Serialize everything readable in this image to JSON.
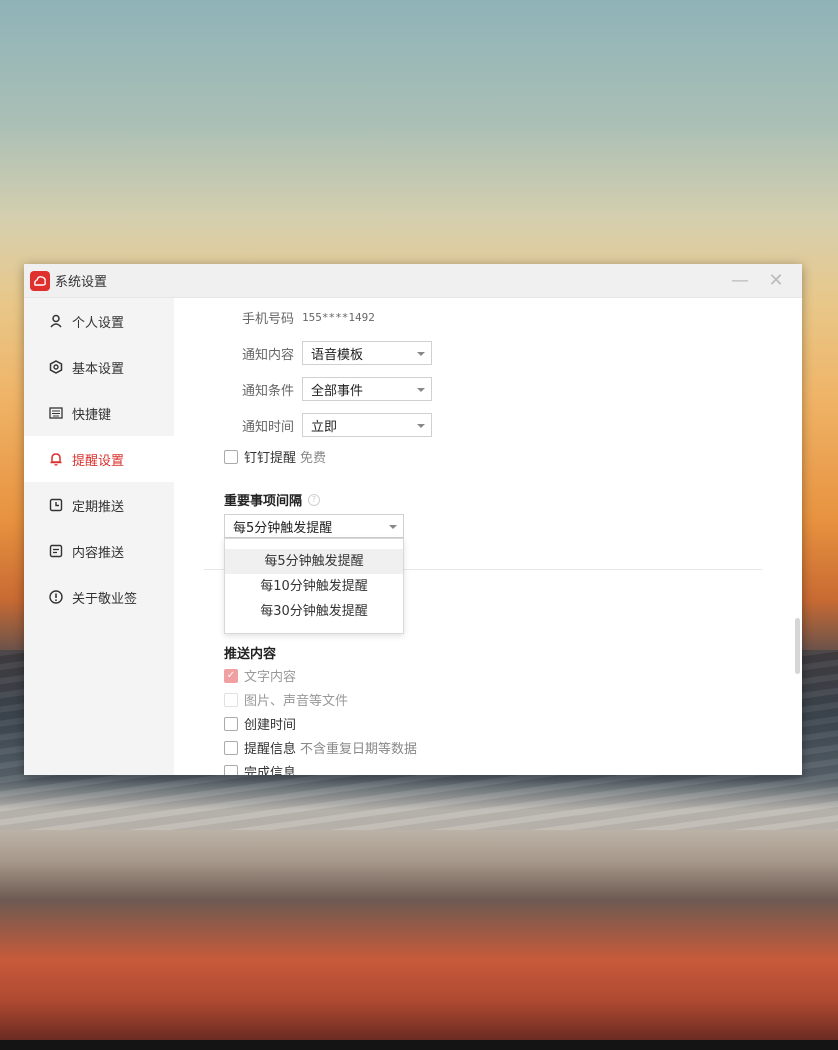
{
  "window": {
    "title": "系统设置"
  },
  "sidebar": {
    "items": [
      {
        "label": "个人设置",
        "icon": "user-icon",
        "active": false
      },
      {
        "label": "基本设置",
        "icon": "hexagon-settings-icon",
        "active": false
      },
      {
        "label": "快捷键",
        "icon": "keyboard-icon",
        "active": false
      },
      {
        "label": "提醒设置",
        "icon": "bell-icon",
        "active": true
      },
      {
        "label": "定期推送",
        "icon": "clock-doc-icon",
        "active": false
      },
      {
        "label": "内容推送",
        "icon": "document-icon",
        "active": false
      },
      {
        "label": "关于敬业签",
        "icon": "info-circle-icon",
        "active": false
      }
    ]
  },
  "reminder": {
    "phone_label": "手机号码",
    "phone_value": "155****1492",
    "notify_content_label": "通知内容",
    "notify_content_value": "语音模板",
    "notify_condition_label": "通知条件",
    "notify_condition_value": "全部事件",
    "notify_time_label": "通知时间",
    "notify_time_value": "立即",
    "dingtalk_label": "钉钉提醒",
    "dingtalk_note": "免费",
    "important_title": "重要事项间隔",
    "important_value": "每5分钟触发提醒",
    "interval_options": [
      "每5分钟触发提醒",
      "每10分钟触发提醒",
      "每30分钟触发提醒"
    ]
  },
  "push": {
    "title": "推送内容",
    "items": [
      {
        "label": "文字内容",
        "checked": true,
        "disabled": true
      },
      {
        "label": "图片、声音等文件",
        "checked": false,
        "disabled": true
      },
      {
        "label": "创建时间",
        "checked": false,
        "disabled": false
      },
      {
        "label": "提醒信息",
        "note": "不含重复日期等数据",
        "checked": false,
        "disabled": false
      },
      {
        "label": "完成信息",
        "checked": false,
        "disabled": false
      }
    ]
  },
  "colors": {
    "accent": "#d9322e",
    "sidebar_bg": "#f4f4f5",
    "titlebar_bg": "#f0f0f1"
  }
}
